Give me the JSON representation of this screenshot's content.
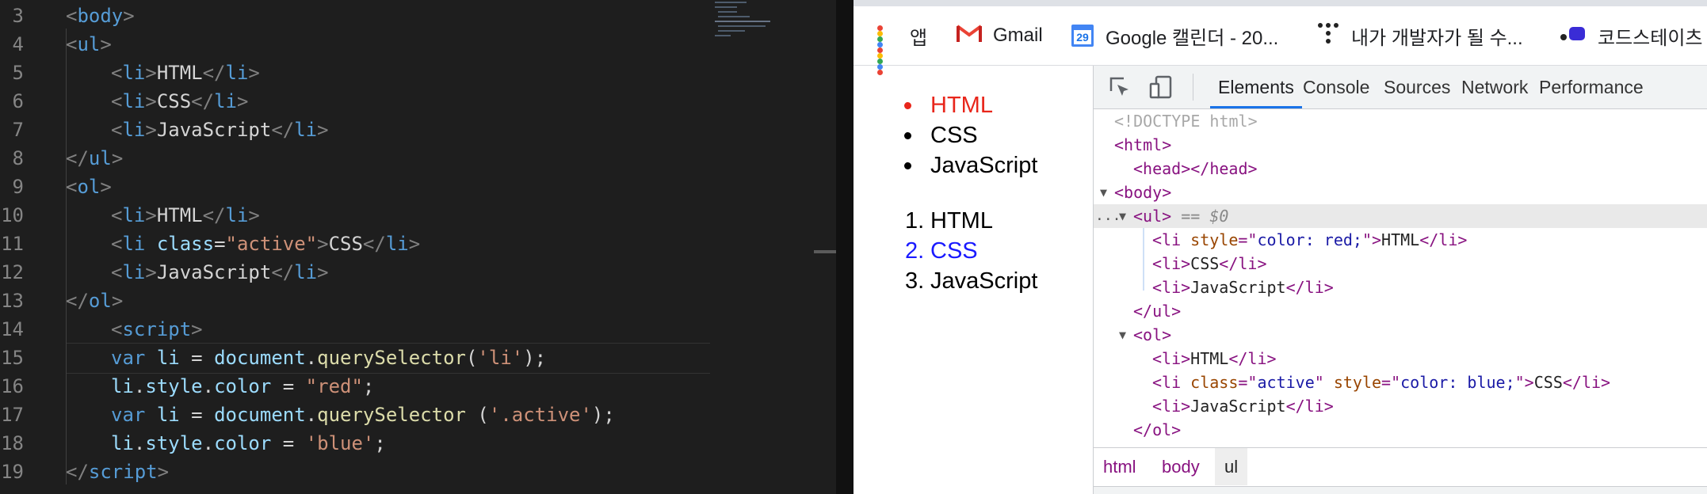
{
  "editor": {
    "lines": [
      {
        "n": "3",
        "indent": 0,
        "tokens": [
          [
            "br",
            "<"
          ],
          [
            "tg",
            "body"
          ],
          [
            "br",
            ">"
          ]
        ]
      },
      {
        "n": "4",
        "indent": 0,
        "tokens": [
          [
            "br",
            "<"
          ],
          [
            "tg",
            "ul"
          ],
          [
            "br",
            ">"
          ]
        ]
      },
      {
        "n": "5",
        "indent": 1,
        "tokens": [
          [
            "br",
            "<"
          ],
          [
            "tg",
            "li"
          ],
          [
            "br",
            ">"
          ],
          [
            "pl",
            "HTML"
          ],
          [
            "br",
            "</"
          ],
          [
            "tg",
            "li"
          ],
          [
            "br",
            ">"
          ]
        ]
      },
      {
        "n": "6",
        "indent": 1,
        "tokens": [
          [
            "br",
            "<"
          ],
          [
            "tg",
            "li"
          ],
          [
            "br",
            ">"
          ],
          [
            "pl",
            "CSS"
          ],
          [
            "br",
            "</"
          ],
          [
            "tg",
            "li"
          ],
          [
            "br",
            ">"
          ]
        ]
      },
      {
        "n": "7",
        "indent": 1,
        "tokens": [
          [
            "br",
            "<"
          ],
          [
            "tg",
            "li"
          ],
          [
            "br",
            ">"
          ],
          [
            "pl",
            "JavaScript"
          ],
          [
            "br",
            "</"
          ],
          [
            "tg",
            "li"
          ],
          [
            "br",
            ">"
          ]
        ]
      },
      {
        "n": "8",
        "indent": 0,
        "tokens": [
          [
            "br",
            "</"
          ],
          [
            "tg",
            "ul"
          ],
          [
            "br",
            ">"
          ]
        ]
      },
      {
        "n": "9",
        "indent": 0,
        "tokens": [
          [
            "br",
            "<"
          ],
          [
            "tg",
            "ol"
          ],
          [
            "br",
            ">"
          ]
        ]
      },
      {
        "n": "10",
        "indent": 1,
        "tokens": [
          [
            "br",
            "<"
          ],
          [
            "tg",
            "li"
          ],
          [
            "br",
            ">"
          ],
          [
            "pl",
            "HTML"
          ],
          [
            "br",
            "</"
          ],
          [
            "tg",
            "li"
          ],
          [
            "br",
            ">"
          ]
        ]
      },
      {
        "n": "11",
        "indent": 1,
        "tokens": [
          [
            "br",
            "<"
          ],
          [
            "tg",
            "li"
          ],
          [
            "pl",
            " "
          ],
          [
            "at",
            "class"
          ],
          [
            "pl",
            "="
          ],
          [
            "st",
            "\"active\""
          ],
          [
            "br",
            ">"
          ],
          [
            "pl",
            "CSS"
          ],
          [
            "br",
            "</"
          ],
          [
            "tg",
            "li"
          ],
          [
            "br",
            ">"
          ]
        ]
      },
      {
        "n": "12",
        "indent": 1,
        "tokens": [
          [
            "br",
            "<"
          ],
          [
            "tg",
            "li"
          ],
          [
            "br",
            ">"
          ],
          [
            "pl",
            "JavaScript"
          ],
          [
            "br",
            "</"
          ],
          [
            "tg",
            "li"
          ],
          [
            "br",
            ">"
          ]
        ]
      },
      {
        "n": "13",
        "indent": 0,
        "tokens": [
          [
            "br",
            "</"
          ],
          [
            "tg",
            "ol"
          ],
          [
            "br",
            ">"
          ]
        ]
      },
      {
        "n": "14",
        "indent": 1,
        "tokens": [
          [
            "br",
            "<"
          ],
          [
            "tg",
            "script"
          ],
          [
            "br",
            ">"
          ]
        ]
      },
      {
        "n": "15",
        "indent": 1,
        "tokens": [
          [
            "tg",
            "var"
          ],
          [
            "pl",
            " "
          ],
          [
            "at",
            "li"
          ],
          [
            "pl",
            " = "
          ],
          [
            "at",
            "document"
          ],
          [
            "pl",
            "."
          ],
          [
            "fn",
            "querySelector"
          ],
          [
            "pl",
            "("
          ],
          [
            "st",
            "'li'"
          ],
          [
            "pl",
            ");"
          ]
        ]
      },
      {
        "n": "16",
        "indent": 1,
        "tokens": [
          [
            "at",
            "li"
          ],
          [
            "pl",
            "."
          ],
          [
            "at",
            "style"
          ],
          [
            "pl",
            "."
          ],
          [
            "at",
            "color"
          ],
          [
            "pl",
            " = "
          ],
          [
            "st",
            "\"red\""
          ],
          [
            "pl",
            ";"
          ]
        ]
      },
      {
        "n": "17",
        "indent": 1,
        "tokens": [
          [
            "tg",
            "var"
          ],
          [
            "pl",
            " "
          ],
          [
            "at",
            "li"
          ],
          [
            "pl",
            " = "
          ],
          [
            "at",
            "document"
          ],
          [
            "pl",
            "."
          ],
          [
            "fn",
            "querySelector"
          ],
          [
            "pl",
            " ("
          ],
          [
            "st",
            "'.active'"
          ],
          [
            "pl",
            ");"
          ]
        ]
      },
      {
        "n": "18",
        "indent": 1,
        "tokens": [
          [
            "at",
            "li"
          ],
          [
            "pl",
            "."
          ],
          [
            "at",
            "style"
          ],
          [
            "pl",
            "."
          ],
          [
            "at",
            "color"
          ],
          [
            "pl",
            " = "
          ],
          [
            "st",
            "'blue'"
          ],
          [
            "pl",
            ";"
          ]
        ]
      },
      {
        "n": "19",
        "indent": 0,
        "tokens": [
          [
            "br",
            "</"
          ],
          [
            "tg",
            "script"
          ],
          [
            "br",
            ">"
          ]
        ]
      }
    ]
  },
  "bookmarks": {
    "apps": "앱",
    "gmail": "Gmail",
    "calendar": "Google 캘린더 - 20...",
    "calendar_day": "29",
    "dev": "내가 개발자가 될 수...",
    "codestates": "코드스테이츠 ㅎ"
  },
  "page": {
    "ul_items": [
      {
        "text": "HTML",
        "color": "#e8261b"
      },
      {
        "text": "CSS",
        "color": "#000000"
      },
      {
        "text": "JavaScript",
        "color": "#000000"
      }
    ],
    "ol_items": [
      {
        "num": "1.",
        "text": "HTML",
        "color": "#000000"
      },
      {
        "num": "2.",
        "text": "CSS",
        "color": "#1a1aff"
      },
      {
        "num": "3.",
        "text": "JavaScript",
        "color": "#000000"
      }
    ]
  },
  "devtools": {
    "tabs": [
      "Elements",
      "Console",
      "Sources",
      "Network",
      "Performance"
    ],
    "active_tab": "Elements",
    "dom_lines": [
      {
        "indent": 0,
        "tri": "",
        "parts": [
          [
            "cm",
            "<!DOCTYPE html>"
          ]
        ]
      },
      {
        "indent": 0,
        "tri": "",
        "parts": [
          [
            "tag",
            "<html>"
          ]
        ]
      },
      {
        "indent": 1,
        "tri": "",
        "parts": [
          [
            "tag",
            "<head></head>"
          ]
        ]
      },
      {
        "indent": 0,
        "tri": "▼",
        "parts": [
          [
            "tag",
            "<body>"
          ]
        ]
      },
      {
        "indent": 1,
        "tri": "▼",
        "sel": true,
        "parts": [
          [
            "tag",
            "<ul>"
          ],
          [
            "ref",
            " == $0"
          ]
        ]
      },
      {
        "indent": 2,
        "tri": "",
        "parts": [
          [
            "tag",
            "<li "
          ],
          [
            "an",
            "style"
          ],
          [
            "tag",
            "=\""
          ],
          [
            "av",
            "color: red;"
          ],
          [
            "tag",
            "\">"
          ],
          [
            "tx",
            "HTML"
          ],
          [
            "tag",
            "</li>"
          ]
        ]
      },
      {
        "indent": 2,
        "tri": "",
        "parts": [
          [
            "tag",
            "<li>"
          ],
          [
            "tx",
            "CSS"
          ],
          [
            "tag",
            "</li>"
          ]
        ]
      },
      {
        "indent": 2,
        "tri": "",
        "parts": [
          [
            "tag",
            "<li>"
          ],
          [
            "tx",
            "JavaScript"
          ],
          [
            "tag",
            "</li>"
          ]
        ]
      },
      {
        "indent": 1,
        "tri": "",
        "parts": [
          [
            "tag",
            "</ul>"
          ]
        ]
      },
      {
        "indent": 1,
        "tri": "▼",
        "parts": [
          [
            "tag",
            "<ol>"
          ]
        ]
      },
      {
        "indent": 2,
        "tri": "",
        "parts": [
          [
            "tag",
            "<li>"
          ],
          [
            "tx",
            "HTML"
          ],
          [
            "tag",
            "</li>"
          ]
        ]
      },
      {
        "indent": 2,
        "tri": "",
        "parts": [
          [
            "tag",
            "<li "
          ],
          [
            "an",
            "class"
          ],
          [
            "tag",
            "=\""
          ],
          [
            "av",
            "active"
          ],
          [
            "tag",
            "\" "
          ],
          [
            "an",
            "style"
          ],
          [
            "tag",
            "=\""
          ],
          [
            "av",
            "color: blue;"
          ],
          [
            "tag",
            "\">"
          ],
          [
            "tx",
            "CSS"
          ],
          [
            "tag",
            "</li>"
          ]
        ]
      },
      {
        "indent": 2,
        "tri": "",
        "parts": [
          [
            "tag",
            "<li>"
          ],
          [
            "tx",
            "JavaScript"
          ],
          [
            "tag",
            "</li>"
          ]
        ]
      },
      {
        "indent": 1,
        "tri": "",
        "parts": [
          [
            "tag",
            "</ol>"
          ]
        ]
      }
    ],
    "breadcrumbs": [
      "html",
      "body",
      "ul"
    ],
    "current_crumb": "ul",
    "ellipsis": "..."
  }
}
